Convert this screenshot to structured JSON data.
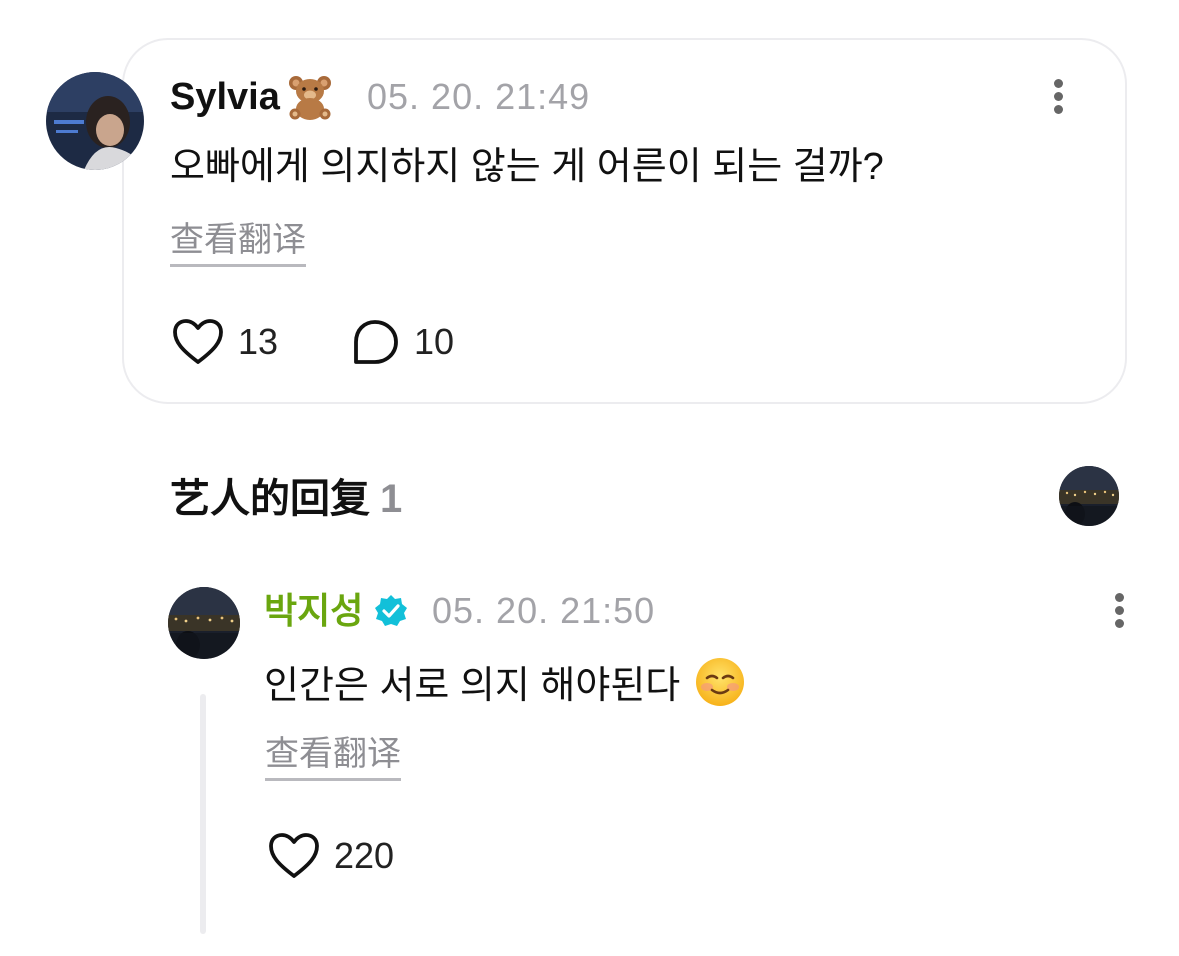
{
  "comment": {
    "author": "Sylvia",
    "author_emoji": "teddy-bear",
    "timestamp": "05. 20. 21:49",
    "text": "오빠에게 의지하지 않는 게 어른이 되는 걸까?",
    "translate_label": "查看翻译",
    "likes": "13",
    "replies": "10"
  },
  "artist_replies": {
    "title": "艺人的回复",
    "count": "1"
  },
  "reply": {
    "author": "박지성",
    "verified": true,
    "timestamp": "05. 20. 21:50",
    "text": "인간은 서로 의지 해야된다",
    "text_emoji": "smiling-face",
    "translate_label": "查看翻译",
    "likes": "220"
  },
  "colors": {
    "artist_name": "#6aa60f",
    "verified_badge": "#12c0d9",
    "muted": "#a3a3a8",
    "card_border": "#ececef"
  }
}
